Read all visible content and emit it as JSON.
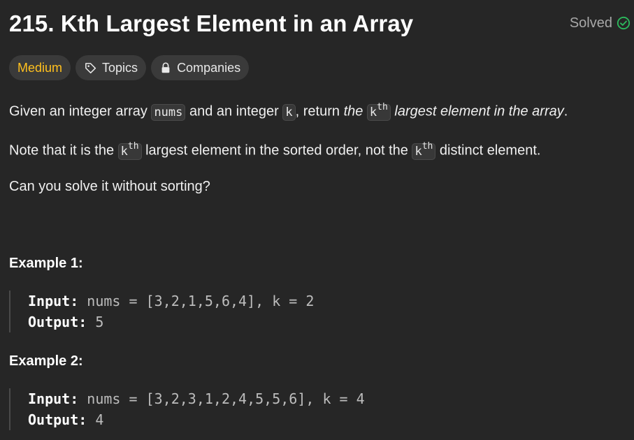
{
  "header": {
    "title": "215. Kth Largest Element in an Array",
    "status_label": "Solved"
  },
  "tags": {
    "difficulty": "Medium",
    "topics": "Topics",
    "companies": "Companies"
  },
  "description": {
    "p1_a": "Given an integer array ",
    "p1_nums": "nums",
    "p1_b": " and an integer ",
    "p1_k": "k",
    "p1_c": ", return ",
    "p1_the": "the ",
    "p1_k2": "k",
    "p1_th": "th",
    "p1_d": " largest element in the array",
    "p1_e": ".",
    "p2_a": "Note that it is the ",
    "p2_k": "k",
    "p2_th": "th",
    "p2_b": " largest element in the sorted order, not the ",
    "p2_k2": "k",
    "p2_th2": "th",
    "p2_c": " distinct element.",
    "p3": "Can you solve it without sorting?"
  },
  "examples": [
    {
      "title": "Example 1:",
      "input_label": "Input:",
      "input_value": "nums = [3,2,1,5,6,4], k = 2",
      "output_label": "Output:",
      "output_value": "5"
    },
    {
      "title": "Example 2:",
      "input_label": "Input:",
      "input_value": "nums = [3,2,3,1,2,4,5,5,6], k = 4",
      "output_label": "Output:",
      "output_value": "4"
    }
  ],
  "colors": {
    "background": "#262626",
    "difficulty_medium": "#ffc01e",
    "solved_check": "#2cbb5d"
  },
  "icons": {
    "solved": "check-circle-icon",
    "topics": "tag-icon",
    "companies": "lock-icon"
  }
}
